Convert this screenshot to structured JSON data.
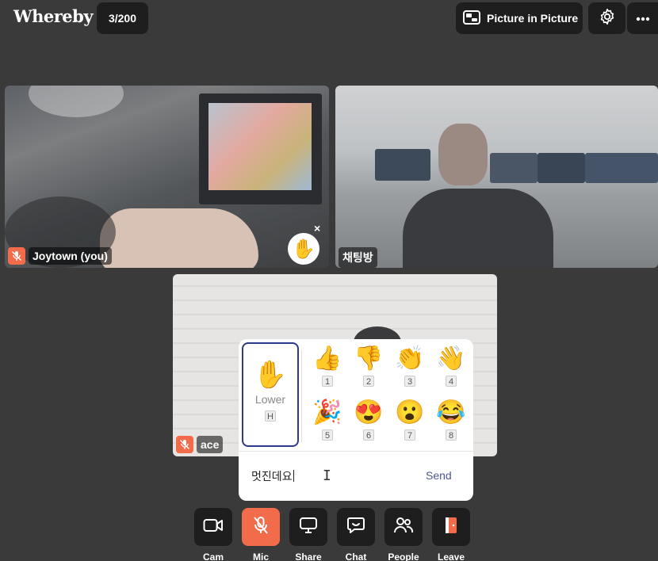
{
  "header": {
    "logo": "Whereby",
    "participant_count": "3/200",
    "pip_label": "Picture in Picture"
  },
  "tiles": [
    {
      "name": "Joytown (you)",
      "mic_muted": true,
      "hand_raised": true,
      "hand_close": "×"
    },
    {
      "name": "채팅방",
      "mic_muted": false
    },
    {
      "name": "ace",
      "mic_muted": true
    }
  ],
  "reactions": {
    "lower": {
      "emoji": "✋",
      "label": "Lower",
      "shortcut": "H"
    },
    "emojis": [
      {
        "glyph": "👍",
        "key": "1"
      },
      {
        "glyph": "👎",
        "key": "2"
      },
      {
        "glyph": "👏",
        "key": "3"
      },
      {
        "glyph": "👋",
        "key": "4"
      },
      {
        "glyph": "🎉",
        "key": "5"
      },
      {
        "glyph": "😍",
        "key": "6"
      },
      {
        "glyph": "😮",
        "key": "7"
      },
      {
        "glyph": "😂",
        "key": "8"
      }
    ],
    "input_value": "멋진데요",
    "send_label": "Send"
  },
  "raised_hand_emoji": "✋",
  "toolbar": {
    "cam": "Cam",
    "mic": "Mic",
    "share": "Share",
    "chat": "Chat",
    "people": "People",
    "leave": "Leave"
  },
  "colors": {
    "background": "#3a3a3a",
    "button_dark": "#1e1e1e",
    "accent_orange": "#f26b4b",
    "send_blue": "#4f5596",
    "lower_border": "#2f3a8a"
  }
}
